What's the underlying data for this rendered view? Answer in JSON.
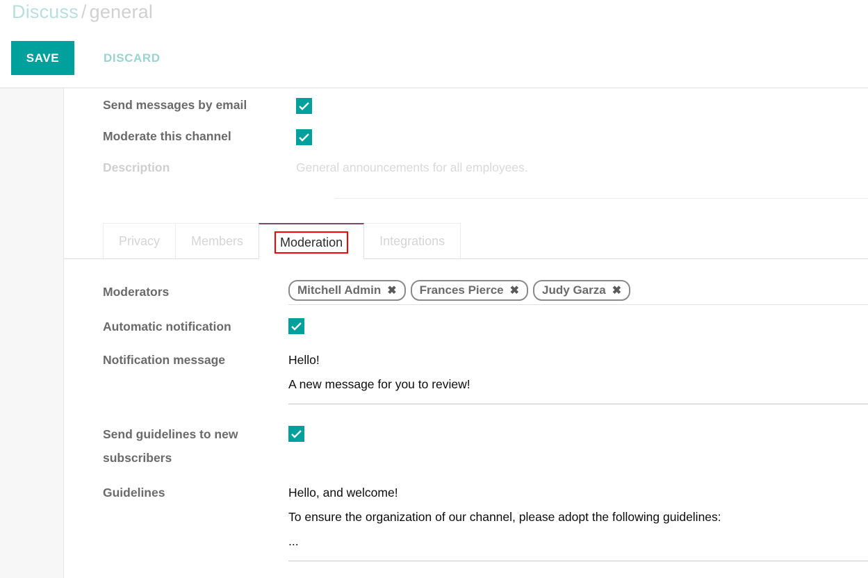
{
  "control_panel": {
    "breadcrumb": {
      "parent": "Discuss",
      "separator": "/",
      "current": "general"
    },
    "save_label": "SAVE",
    "discard_label": "DISCARD"
  },
  "form": {
    "rows": [
      {
        "label": "Send messages by email",
        "type": "checkbox",
        "checked": true
      },
      {
        "label": "Moderate this channel",
        "type": "checkbox",
        "checked": true
      },
      {
        "label": "Description",
        "type": "text",
        "value": "General announcements for all employees."
      }
    ]
  },
  "notebook": {
    "tabs": [
      {
        "label": "Privacy",
        "active": false
      },
      {
        "label": "Members",
        "active": false
      },
      {
        "label": "Moderation",
        "active": true,
        "annotated": true
      },
      {
        "label": "Integrations",
        "active": false
      }
    ]
  },
  "moderation": {
    "moderators_label": "Moderators",
    "moderators": [
      {
        "name": "Mitchell Admin",
        "remove": "✖"
      },
      {
        "name": "Frances Pierce",
        "remove": "✖"
      },
      {
        "name": "Judy Garza",
        "remove": "✖"
      }
    ],
    "automatic_notification_label": "Automatic notification",
    "automatic_notification_checked": true,
    "notification_message_label": "Notification message",
    "notification_message_lines": [
      "Hello!",
      "A new message for you to review!"
    ],
    "send_guidelines_label": "Send guidelines to new subscribers",
    "send_guidelines_checked": true,
    "guidelines_label": "Guidelines",
    "guidelines_lines": [
      "Hello, and welcome!",
      "To ensure the organization of our channel, please adopt the following guidelines:",
      "..."
    ]
  },
  "colors": {
    "accent": "#00a09d",
    "accent_light": "#9ad3d1",
    "active_tab_border": "#7c4a6d",
    "annotation": "#ff0000"
  }
}
